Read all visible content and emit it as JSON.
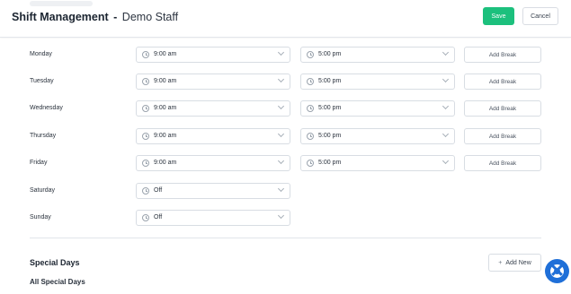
{
  "header": {
    "title_bold": "Shift Management",
    "separator": "-",
    "staff_name": "Demo Staff",
    "save_label": "Save",
    "cancel_label": "Cancel"
  },
  "schedule": {
    "days": [
      {
        "day": "Monday",
        "start": "9:00 am",
        "end": "5:00 pm",
        "break_label": "Add Break"
      },
      {
        "day": "Tuesday",
        "start": "9:00 am",
        "end": "5:00 pm",
        "break_label": "Add Break"
      },
      {
        "day": "Wednesday",
        "start": "9:00 am",
        "end": "5:00 pm",
        "break_label": "Add Break"
      },
      {
        "day": "Thursday",
        "start": "9:00 am",
        "end": "5:00 pm",
        "break_label": "Add Break"
      },
      {
        "day": "Friday",
        "start": "9:00 am",
        "end": "5:00 pm",
        "break_label": "Add Break"
      },
      {
        "day": "Saturday",
        "start": "Off"
      },
      {
        "day": "Sunday",
        "start": "Off"
      }
    ]
  },
  "special_days": {
    "title": "Special Days",
    "add_new_label": "Add New",
    "all_label": "All Special Days"
  },
  "colors": {
    "save_green": "#1cc07d",
    "help_blue": "#1f6fd8"
  },
  "icons": {
    "time_select": "clock-icon",
    "dropdown": "chevron-down-icon",
    "add": "plus-icon",
    "help": "lifebuoy-icon"
  }
}
